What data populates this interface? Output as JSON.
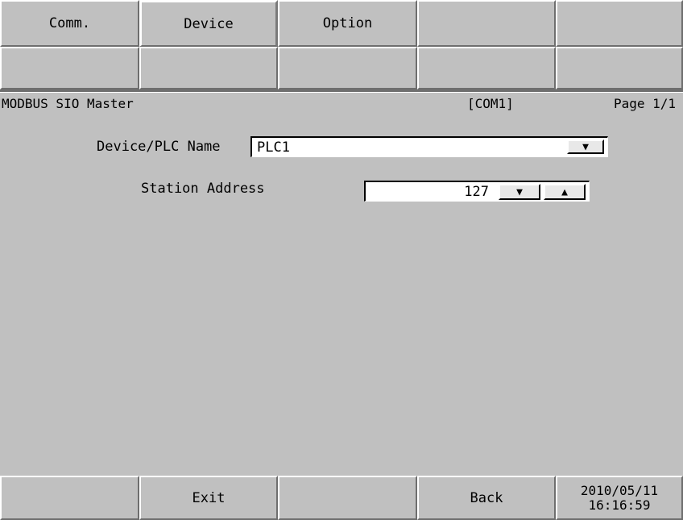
{
  "tabs": [
    {
      "label": "Comm."
    },
    {
      "label": "Device"
    },
    {
      "label": "Option"
    },
    {
      "label": ""
    },
    {
      "label": ""
    }
  ],
  "header": {
    "protocol": "MODBUS SIO Master",
    "port": "[COM1]",
    "page": "Page 1/1"
  },
  "form": {
    "device_label": "Device/PLC Name",
    "device_value": "PLC1",
    "station_label": "Station Address",
    "station_value": "127"
  },
  "icons": {
    "dropdown": "triangle-down",
    "decrement": "triangle-down",
    "increment": "triangle-up"
  },
  "footer": {
    "exit_label": "Exit",
    "back_label": "Back",
    "date": "2010/05/11",
    "time": "16:16:59"
  }
}
